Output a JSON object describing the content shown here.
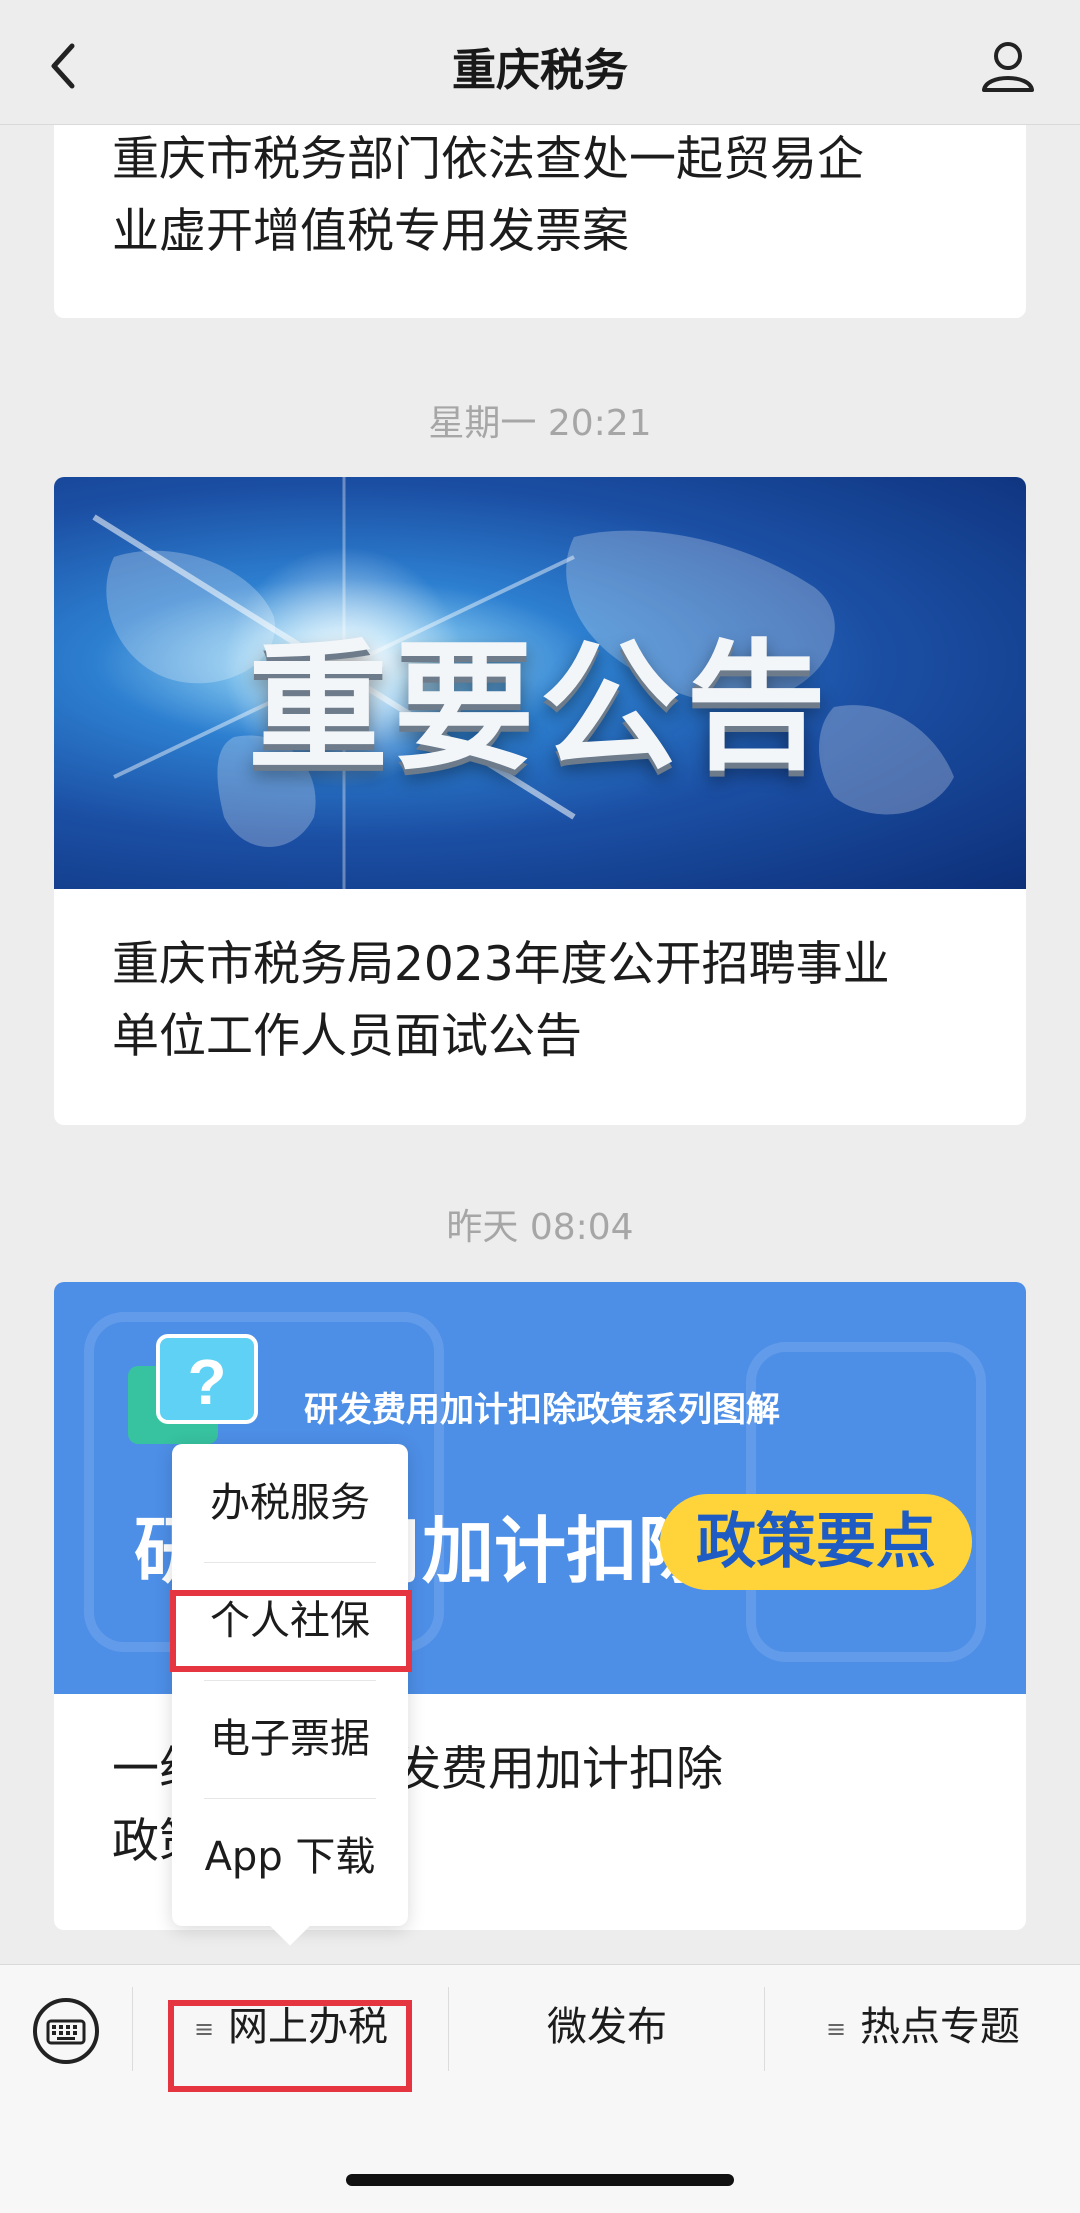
{
  "header": {
    "title": "重庆税务",
    "back_icon": "chevron-left-icon",
    "profile_icon": "user-profile-icon"
  },
  "articles": [
    {
      "headline_line1": "重庆市税务部门依法查处一起贸易企",
      "headline_line2": "业虚开增值税专用发票案"
    },
    {
      "time": "星期一 20:21",
      "banner_text": "重要公告",
      "headline_line1": "重庆市税务局2023年度公开招聘事业",
      "headline_line2": "单位工作人员面试公告"
    },
    {
      "time": "昨天 08:04",
      "banner_subtitle": "研发费用加计扣除政策系列图解",
      "banner_main": "研发费用加计扣除",
      "banner_pill": "政策要点",
      "headline_line1": "一组图解：研发费用加计扣除",
      "headline_line2": "政策要点"
    }
  ],
  "popup_menu": {
    "items": [
      "办税服务",
      "个人社保",
      "电子票据",
      "App 下载"
    ],
    "highlighted_index": 1
  },
  "bottom_menu": {
    "keyboard_icon": "keyboard-icon",
    "items": [
      {
        "label": "网上办税",
        "has_submenu": true,
        "highlighted": true
      },
      {
        "label": "微发布",
        "has_submenu": false
      },
      {
        "label": "热点专题",
        "has_submenu": true
      }
    ]
  },
  "colors": {
    "highlight": "#e53540",
    "background": "#ededed",
    "banner2_pill": "#ffd43b"
  }
}
